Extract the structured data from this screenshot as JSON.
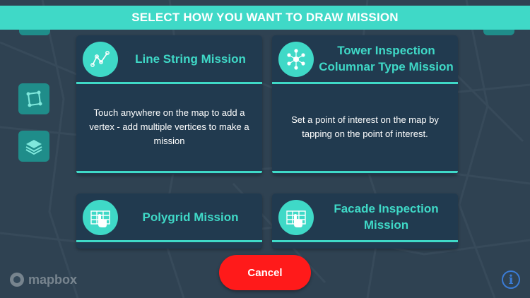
{
  "header": {
    "title": "SELECT HOW YOU WANT TO DRAW MISSION"
  },
  "cards": [
    {
      "title": "Line String Mission",
      "icon": "line-string-icon",
      "description": "Touch anywhere on the map to add a vertex - add multiple vertices to make a mission"
    },
    {
      "title": "Tower Inspection Columnar Type Mission",
      "icon": "tower-network-icon",
      "description": "Set a point of interest on the map by tapping on the point of interest."
    },
    {
      "title": "Polygrid Mission",
      "icon": "grid-touch-icon",
      "description": ""
    },
    {
      "title": "Facade Inspection Mission",
      "icon": "grid-touch-icon",
      "description": ""
    }
  ],
  "cancel_label": "Cancel",
  "map": {
    "attribution": "mapbox",
    "info_label": "i"
  },
  "colors": {
    "accent": "#3fd9c7",
    "card_bg": "#213a4f",
    "cancel": "#ff1a1a"
  }
}
